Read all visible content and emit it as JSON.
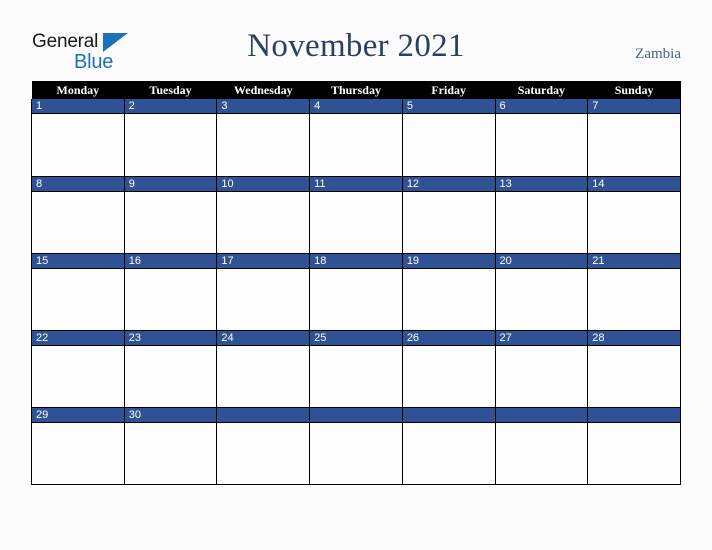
{
  "brand": {
    "name_part1": "General",
    "name_part2": "Blue",
    "triangle_icon": "triangle-right-icon",
    "primary_color": "#1c72b8"
  },
  "header": {
    "title": "November 2021",
    "country": "Zambia",
    "title_color": "#2b3f66",
    "country_color": "#4a5f8c"
  },
  "calendar": {
    "month": "November",
    "year": "2021",
    "header_bg": "#000000",
    "daynum_bg": "#2e5293",
    "cell_bg": "#fdfdfd",
    "weekday_headers": [
      "Monday",
      "Tuesday",
      "Wednesday",
      "Thursday",
      "Friday",
      "Saturday",
      "Sunday"
    ],
    "weeks": [
      {
        "days": [
          {
            "num": "1"
          },
          {
            "num": "2"
          },
          {
            "num": "3"
          },
          {
            "num": "4"
          },
          {
            "num": "5"
          },
          {
            "num": "6"
          },
          {
            "num": "7"
          }
        ]
      },
      {
        "days": [
          {
            "num": "8"
          },
          {
            "num": "9"
          },
          {
            "num": "10"
          },
          {
            "num": "11"
          },
          {
            "num": "12"
          },
          {
            "num": "13"
          },
          {
            "num": "14"
          }
        ]
      },
      {
        "days": [
          {
            "num": "15"
          },
          {
            "num": "16"
          },
          {
            "num": "17"
          },
          {
            "num": "18"
          },
          {
            "num": "19"
          },
          {
            "num": "20"
          },
          {
            "num": "21"
          }
        ]
      },
      {
        "days": [
          {
            "num": "22"
          },
          {
            "num": "23"
          },
          {
            "num": "24"
          },
          {
            "num": "25"
          },
          {
            "num": "26"
          },
          {
            "num": "27"
          },
          {
            "num": "28"
          }
        ]
      },
      {
        "days": [
          {
            "num": "29"
          },
          {
            "num": "30"
          },
          {
            "num": ""
          },
          {
            "num": ""
          },
          {
            "num": ""
          },
          {
            "num": ""
          },
          {
            "num": ""
          }
        ]
      }
    ]
  }
}
